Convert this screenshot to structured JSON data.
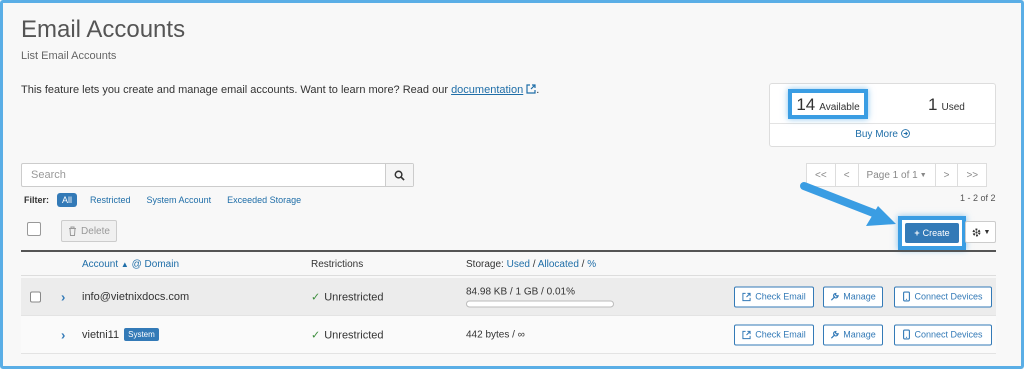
{
  "page": {
    "title": "Email Accounts",
    "subtitle": "List Email Accounts",
    "intro_text": "This feature lets you create and manage email accounts. Want to learn more? Read our",
    "intro_link": "documentation",
    "intro_end": "."
  },
  "stats": {
    "available_count": "14",
    "available_label": "Available",
    "used_count": "1",
    "used_label": "Used",
    "buy_more": "Buy More"
  },
  "search": {
    "placeholder": "Search"
  },
  "pager": {
    "first": "<<",
    "prev": "<",
    "page_label": "Page 1 of 1",
    "next": ">",
    "last": ">>",
    "count_text": "1 - 2 of 2"
  },
  "filter": {
    "label": "Filter:",
    "items": [
      "All",
      "Restricted",
      "System Account",
      "Exceeded Storage"
    ],
    "active": "All"
  },
  "toolbar": {
    "delete_label": "Delete",
    "create_label": "Create"
  },
  "table": {
    "headers": {
      "account": "Account",
      "at_domain": "@ Domain",
      "restrictions": "Restrictions",
      "storage_prefix": "Storage:",
      "used": "Used",
      "allocated": "Allocated",
      "percent": "%",
      "sep": "/"
    },
    "rows": [
      {
        "account": "info@vietnixdocs.com",
        "badge": "",
        "restriction": "Unrestricted",
        "storage": "84.98 KB / 1 GB / 0.01%",
        "usage_fraction": 0.0001,
        "actions": [
          "Check Email",
          "Manage",
          "Connect Devices"
        ]
      },
      {
        "account": "vietni11",
        "badge": "System",
        "restriction": "Unrestricted",
        "storage": "442 bytes / ∞",
        "actions": [
          "Check Email",
          "Manage",
          "Connect Devices"
        ]
      }
    ]
  },
  "colors": {
    "accent": "#337ab7",
    "highlight": "#3a9de3",
    "success": "#3c8d3c"
  }
}
